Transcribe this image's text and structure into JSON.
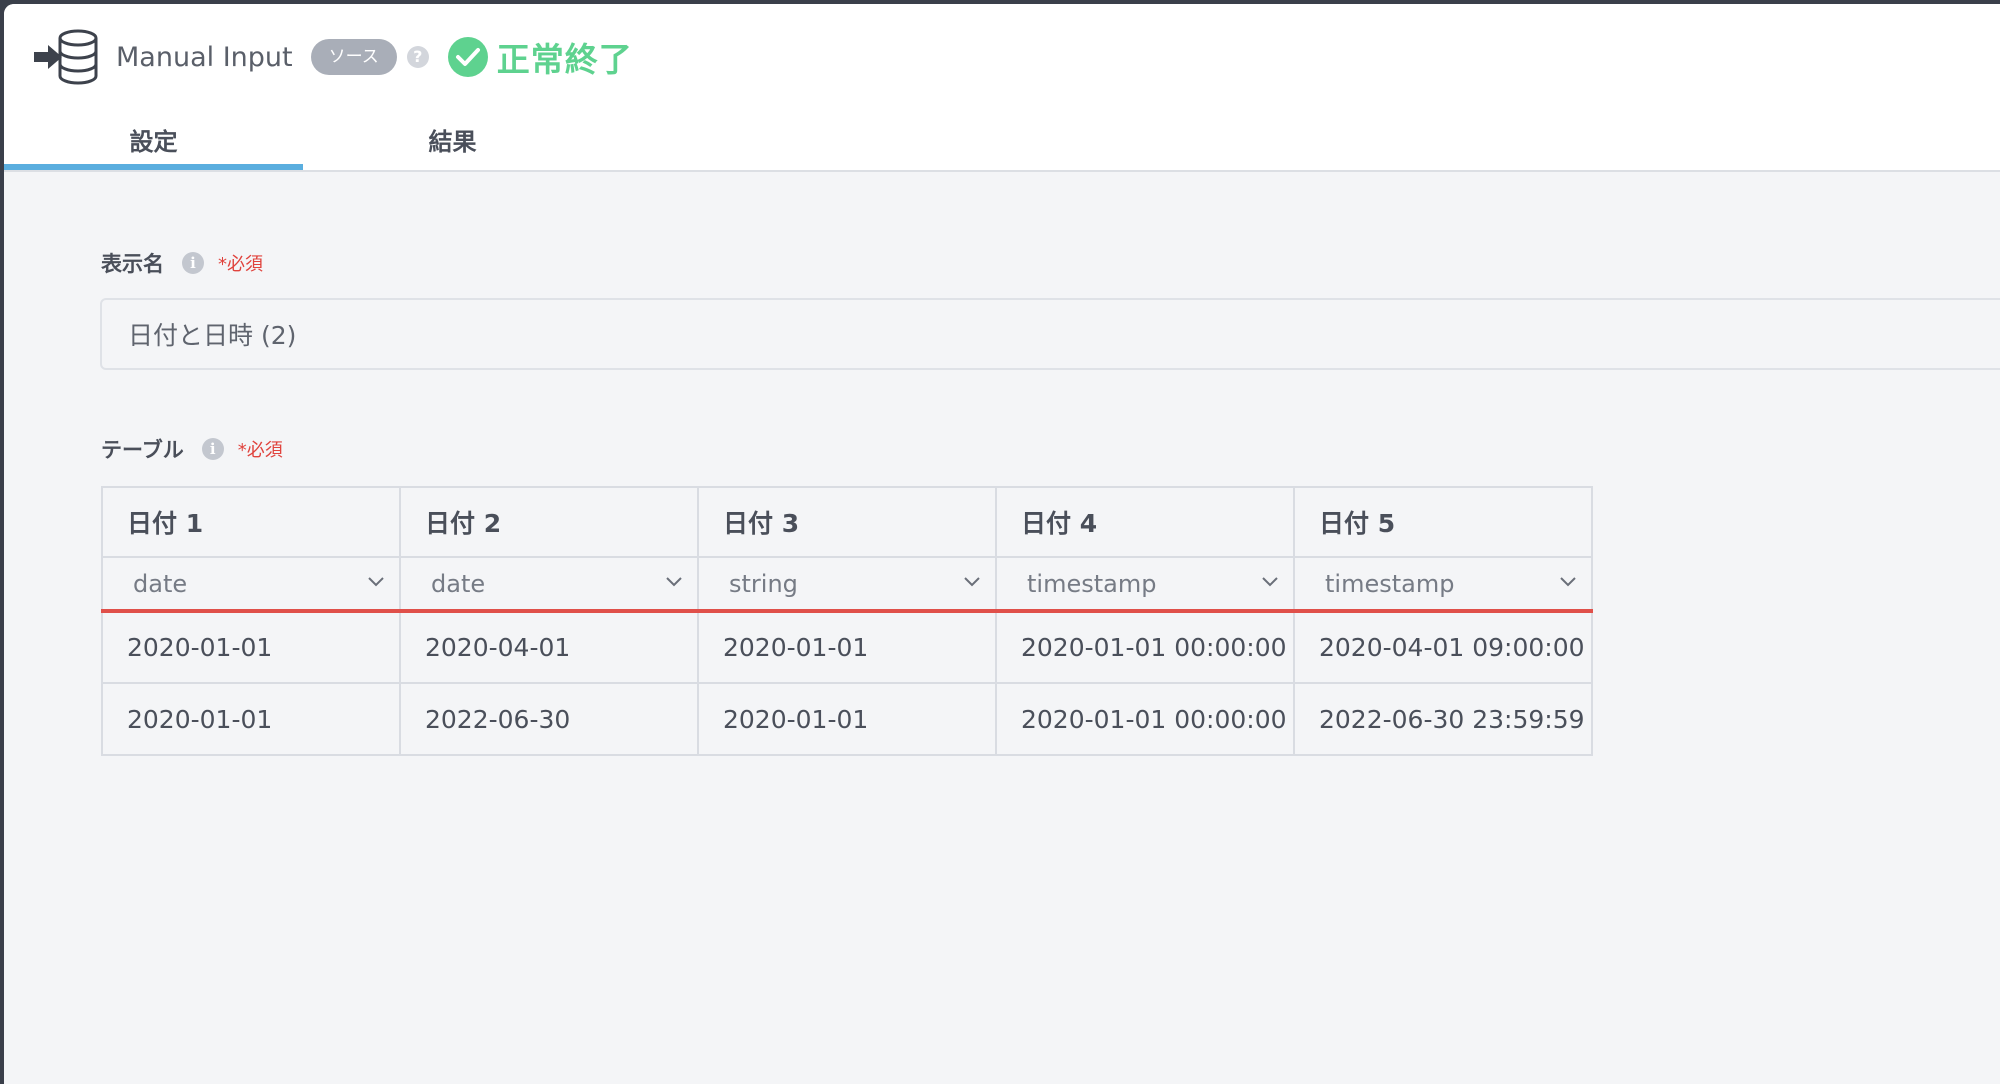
{
  "header": {
    "title": "Manual Input",
    "badge": "ソース",
    "help": "?",
    "status": "正常終了"
  },
  "tabs": [
    {
      "label": "設定",
      "active": true
    },
    {
      "label": "結果",
      "active": false
    }
  ],
  "display_name": {
    "label": "表示名",
    "info": "i",
    "required": "*必須",
    "value": "日付と日時 (2)"
  },
  "table": {
    "label": "テーブル",
    "info": "i",
    "required": "*必須",
    "columns": [
      {
        "name": "日付 1",
        "type": "date"
      },
      {
        "name": "日付 2",
        "type": "date"
      },
      {
        "name": "日付 3",
        "type": "string"
      },
      {
        "name": "日付 4",
        "type": "timestamp"
      },
      {
        "name": "日付 5",
        "type": "timestamp"
      }
    ],
    "rows": [
      [
        "2020-01-01",
        "2020-04-01",
        "2020-01-01",
        "2020-01-01 00:00:00",
        "2020-04-01 09:00:00"
      ],
      [
        "2020-01-01",
        "2022-06-30",
        "2020-01-01",
        "2020-01-01 00:00:00",
        "2022-06-30 23:59:59"
      ]
    ]
  },
  "colors": {
    "accent": "#5aaedf",
    "success": "#5ed28f",
    "required": "#e0433d",
    "type_underline": "#e0504a"
  }
}
